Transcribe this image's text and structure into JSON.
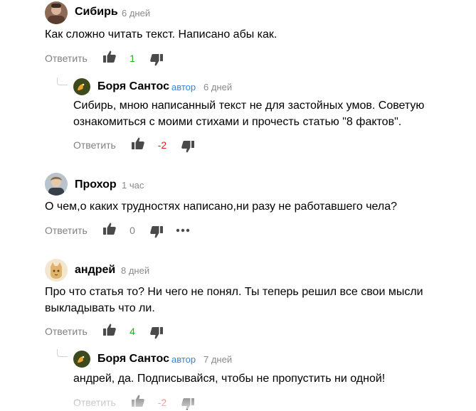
{
  "comments": [
    {
      "author": "Сибирь",
      "time": "6 дней",
      "text": "Как сложно читать текст. Написано абы как.",
      "reply_label": "Ответить",
      "score": "1",
      "avatar": "photo-avatar"
    },
    {
      "author": "Боря Сантос",
      "badge": "автор",
      "time": "6 дней",
      "text_lines": [
        "Сибирь, мною написанный текст не для застойных умов. Советую",
        "ознакомиться с моими стихами и прочесть статью \"8 фактов\"."
      ],
      "reply_label": "Ответить",
      "score": "-2",
      "avatar": "bird-avatar"
    },
    {
      "author": "Прохор",
      "time": "1 час",
      "text": "О чем,о каких трудностях написано,ни разу не работавшего чела?",
      "reply_label": "Ответить",
      "score": "0",
      "avatar": "photo-avatar"
    },
    {
      "author": "андрей",
      "time": "8 дней",
      "text_lines": [
        "Про что статья то? Ни чего не понял. Ты теперь решил все свои мысли",
        "выкладывать что ли."
      ],
      "reply_label": "Ответить",
      "score": "4",
      "avatar": "cat-avatar"
    },
    {
      "author": "Боря Сантос",
      "badge": "автор",
      "time": "7 дней",
      "text": "андрей, да. Подписывайся, чтобы не пропустить ни одной!",
      "reply_label": "Ответить",
      "score": "-2",
      "avatar": "bird-avatar"
    }
  ],
  "colors": {
    "positive": "#1db31d",
    "negative": "#e02020",
    "neutral": "#808080",
    "author_badge": "#3b82d6",
    "icon": "#4a4a4a"
  }
}
